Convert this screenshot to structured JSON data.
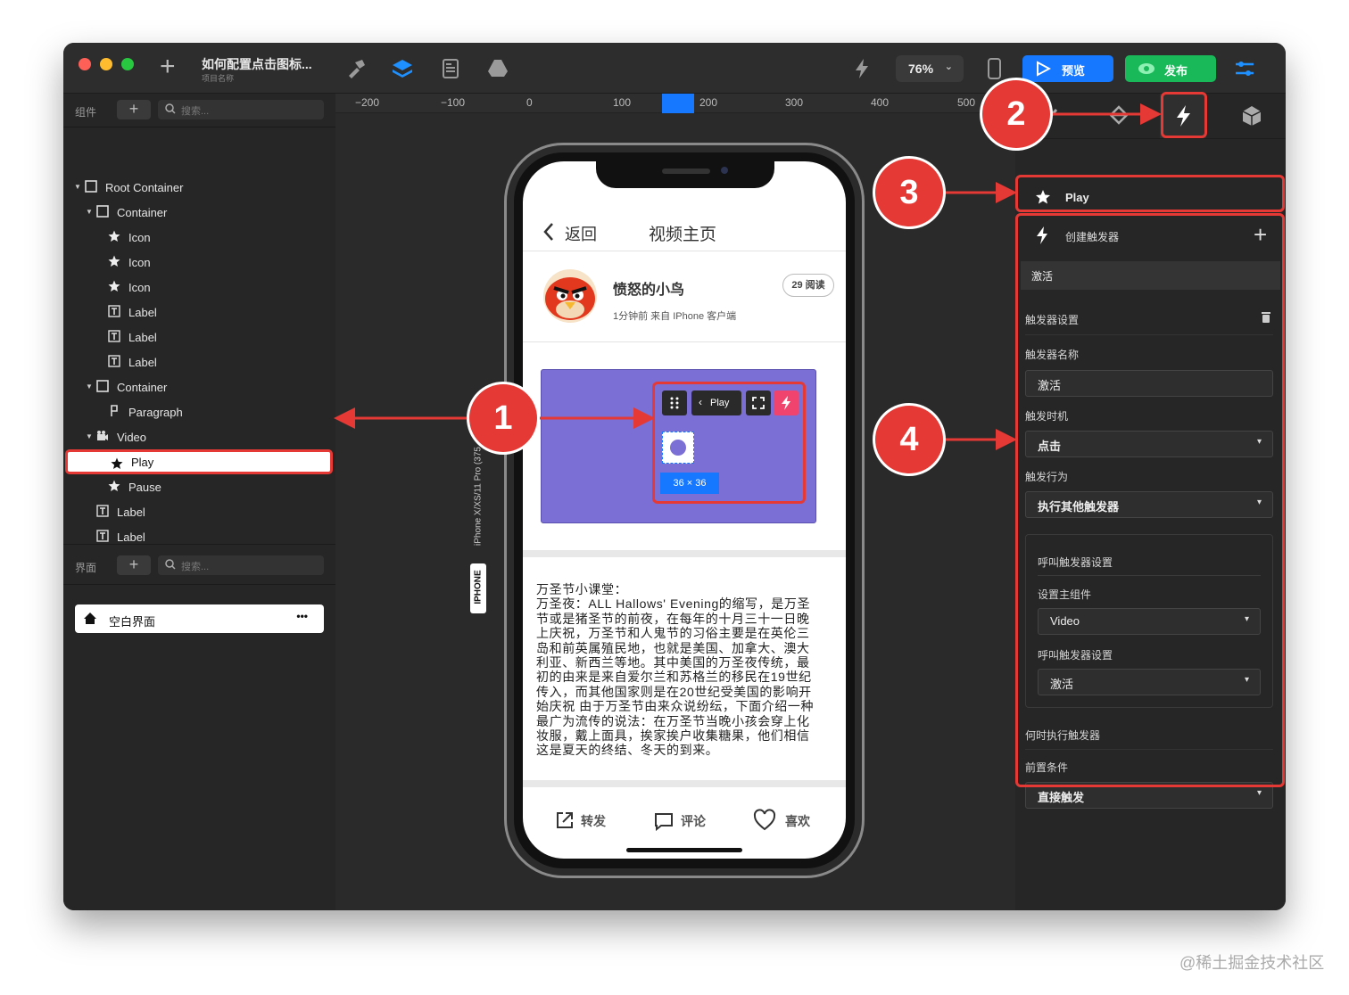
{
  "titlebar": {
    "project_title": "如何配置点击图标...",
    "project_subtitle": "项目名称",
    "zoom": "76%",
    "preview_label": "预览",
    "publish_label": "发布"
  },
  "left_panel": {
    "components_label": "组件",
    "search_placeholder": "搜索...",
    "tree": [
      {
        "label": "Root Container",
        "icon": "container-icon"
      },
      {
        "label": "Container",
        "icon": "container-icon"
      },
      {
        "label": "Icon",
        "icon": "star-icon"
      },
      {
        "label": "Icon",
        "icon": "star-icon"
      },
      {
        "label": "Icon",
        "icon": "star-icon"
      },
      {
        "label": "Label",
        "icon": "text-icon"
      },
      {
        "label": "Label",
        "icon": "text-icon"
      },
      {
        "label": "Label",
        "icon": "text-icon"
      },
      {
        "label": "Container",
        "icon": "container-icon"
      },
      {
        "label": "Paragraph",
        "icon": "paragraph-icon"
      },
      {
        "label": "Video",
        "icon": "video-icon"
      },
      {
        "label": "Play",
        "icon": "star-icon",
        "selected": true
      },
      {
        "label": "Pause",
        "icon": "star-icon"
      },
      {
        "label": "Label",
        "icon": "text-icon"
      },
      {
        "label": "Label",
        "icon": "text-icon"
      }
    ],
    "pages_label": "界面",
    "pages_search_placeholder": "搜索...",
    "page_item": "空白界面",
    "page_more": "•••"
  },
  "ruler": {
    "labels": [
      "-200",
      "-100",
      "0",
      "100",
      "200",
      "300",
      "400",
      "500"
    ]
  },
  "device": {
    "vertical_label": "iPhone X/XS/11 Pro (375",
    "badge": "IPHONE"
  },
  "phone": {
    "back_label": "返回",
    "nav_title": "视频主页",
    "author": "愤怒的小鸟",
    "meta": "1分钟前  来自 IPhone 客户端",
    "reads": "29 阅读",
    "toolbar_play": "Play",
    "size_badge": "36 × 36",
    "article": "万圣节小课堂：\n万圣夜：ALL Hallows' Evening的缩写，是万圣节或是猪圣节的前夜，在每年的十月三十一日晚上庆祝，万圣节和人鬼节的习俗主要是在英伦三岛和前英属殖民地，也就是美国、加拿大、澳大利亚、新西兰等地。其中美国的万圣夜传统，最初的由来是来自爱尔兰和苏格兰的移民在19世纪传入，而其他国家则是在20世纪受美国的影响开始庆祝 由于万圣节由来众说纷纭，下面介绍一种最广为流传的说法：在万圣节当晚小孩会穿上化妆服，戴上面具，挨家挨户收集糖果，他们相信这是夏天的终结、冬天的到来。",
    "share": "转发",
    "comment": "评论",
    "like": "喜欢"
  },
  "right_panel": {
    "selected_name": "Play",
    "create_trigger": "创建触发器",
    "trigger_header": "激活",
    "trigger_settings": "触发器设置",
    "name_label": "触发器名称",
    "name_value": "激活",
    "timing_label": "触发时机",
    "timing_value": "点击",
    "action_label": "触发行为",
    "action_value": "执行其他触发器",
    "call_settings": "呼叫触发器设置",
    "main_component_label": "设置主组件",
    "main_component_value": "Video",
    "call_settings2": "呼叫触发器设置",
    "call_value": "激活",
    "when_label": "何时执行触发器",
    "precondition_label": "前置条件",
    "precondition_value": "直接触发"
  },
  "annotations": [
    "1",
    "2",
    "3",
    "4"
  ],
  "watermark": "@稀土掘金技术社区",
  "colors": {
    "accent_blue": "#1677ff",
    "publish_green": "#19b95a",
    "annotation_red": "#e53935",
    "video_purple": "#7b6fd6",
    "trigger_pink": "#f0436e"
  }
}
